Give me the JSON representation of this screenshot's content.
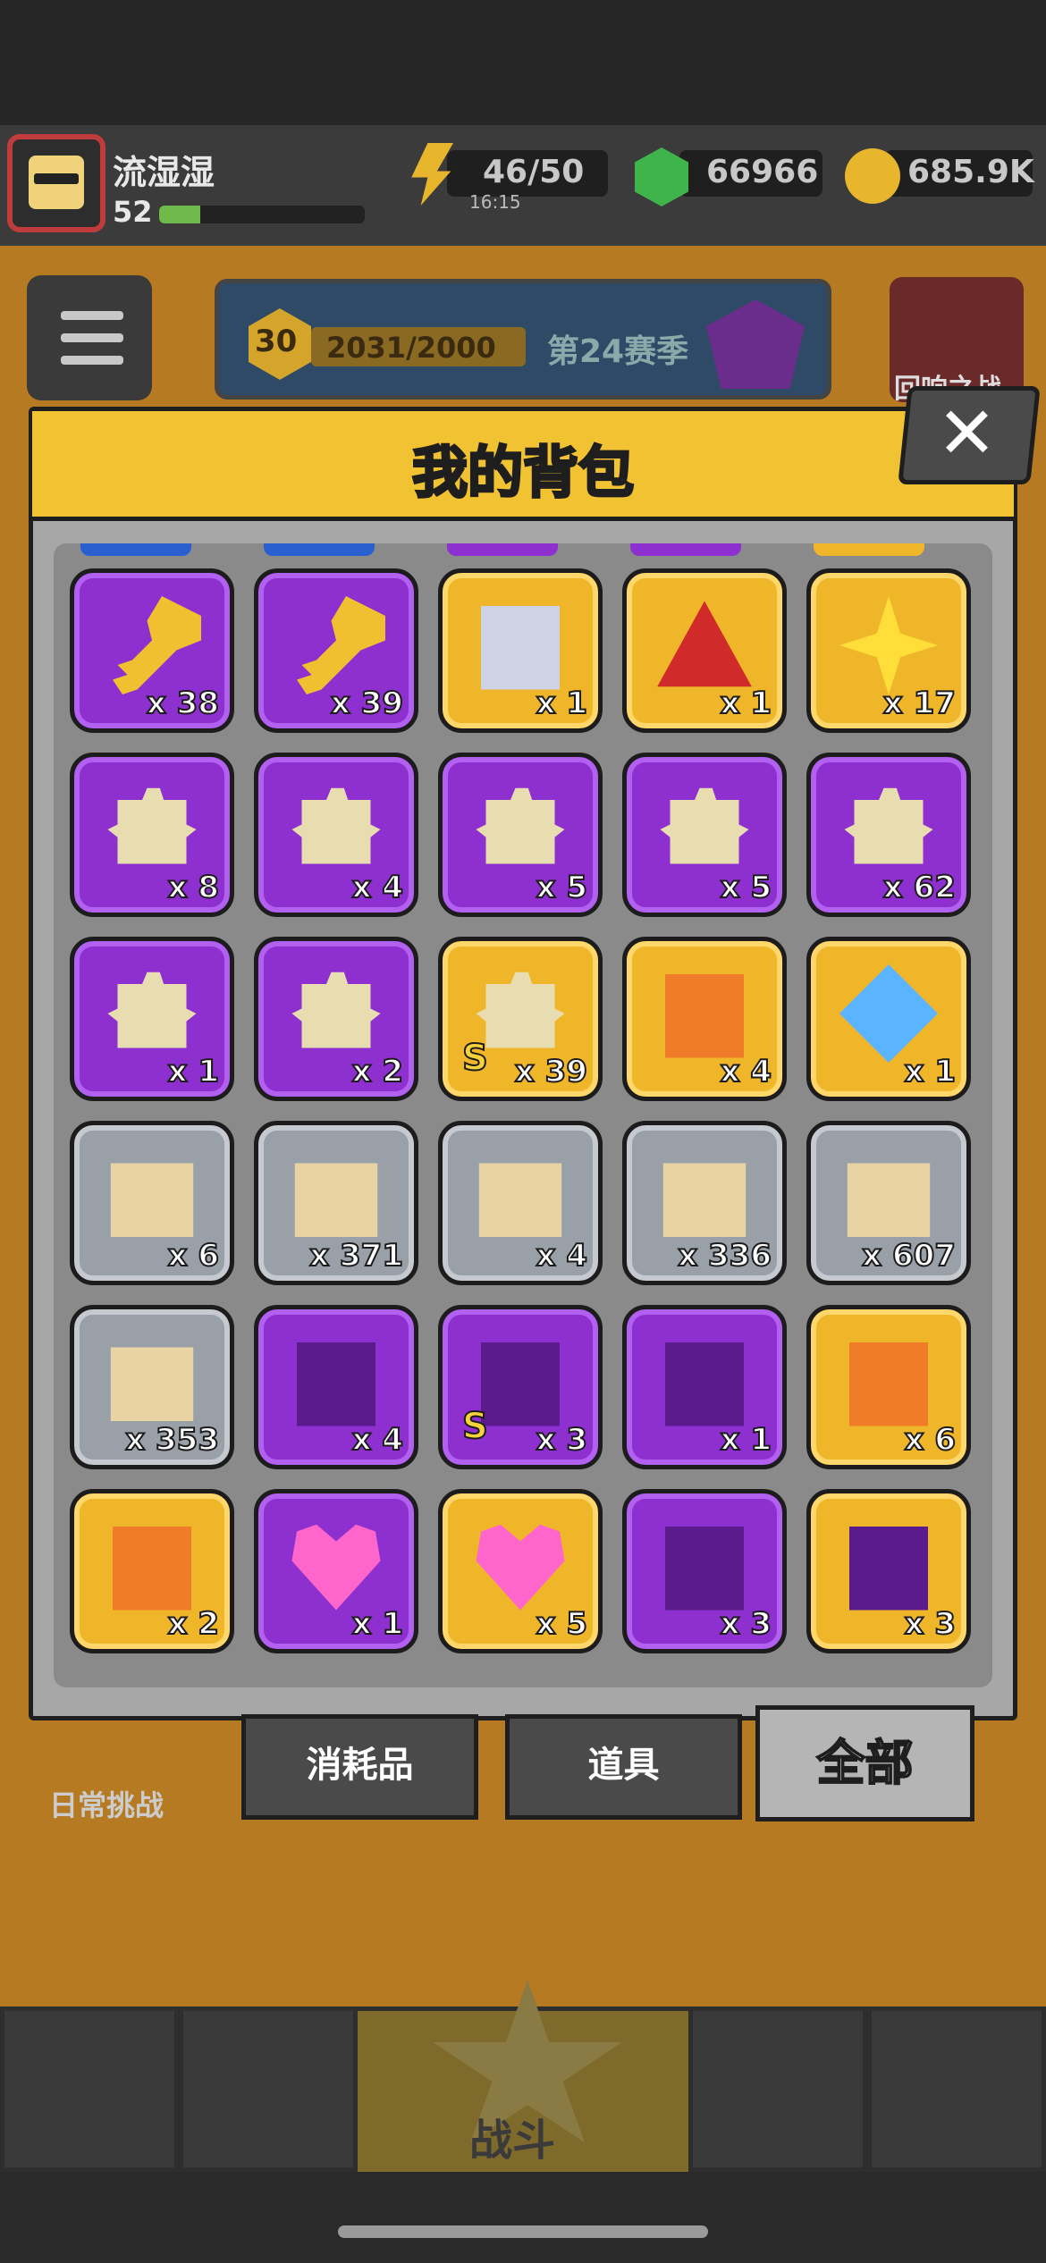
{
  "topbar": {
    "player_name": "流湿湿",
    "player_level": "52",
    "energy": "46/50",
    "energy_timer": "16:15",
    "gems": "66966",
    "coins": "685.9K"
  },
  "season": {
    "level": "30",
    "progress": "2031/2000",
    "name": "第24赛季"
  },
  "background": {
    "event_label": "回响之战",
    "daily_label": "日常挑战",
    "fight_label": "战斗"
  },
  "dialog": {
    "title": "我的背包",
    "close": "✕"
  },
  "items": [
    {
      "icon": "purple-gem-key-icon",
      "rarity": "purple",
      "count": "x 38"
    },
    {
      "icon": "gold-gem-key-icon",
      "rarity": "purple",
      "count": "x 39"
    },
    {
      "icon": "emblem-chest-icon",
      "rarity": "gold",
      "count": "x 1"
    },
    {
      "icon": "red-triangle-icon",
      "rarity": "gold",
      "count": "x 1"
    },
    {
      "icon": "gold-star-icon",
      "rarity": "gold",
      "count": "x 17"
    },
    {
      "icon": "hero-shard-icon",
      "rarity": "purple",
      "count": "x 8"
    },
    {
      "icon": "hero-shard-icon",
      "rarity": "purple",
      "count": "x 4"
    },
    {
      "icon": "hero-shard-icon",
      "rarity": "purple",
      "count": "x 5"
    },
    {
      "icon": "hero-shard-icon",
      "rarity": "purple",
      "count": "x 5"
    },
    {
      "icon": "hero-shard-icon",
      "rarity": "purple",
      "count": "x 62"
    },
    {
      "icon": "hero-shard-icon",
      "rarity": "purple",
      "count": "x 1"
    },
    {
      "icon": "hero-shard-icon",
      "rarity": "purple",
      "count": "x 2"
    },
    {
      "icon": "hero-shard-icon",
      "rarity": "gold",
      "count": "x 39",
      "badge": "S"
    },
    {
      "icon": "gold-chest-icon",
      "rarity": "gold",
      "count": "x 4"
    },
    {
      "icon": "energy-triangle-icon",
      "rarity": "gold",
      "count": "x 1"
    },
    {
      "icon": "weapon-blueprint-icon",
      "rarity": "grey",
      "count": "x 6"
    },
    {
      "icon": "armor-blueprint-icon",
      "rarity": "grey",
      "count": "x 371"
    },
    {
      "icon": "necklace-blueprint-icon",
      "rarity": "grey",
      "count": "x 4"
    },
    {
      "icon": "belt-blueprint-icon",
      "rarity": "grey",
      "count": "x 336"
    },
    {
      "icon": "glove-blueprint-icon",
      "rarity": "grey",
      "count": "x 607"
    },
    {
      "icon": "boots-blueprint-icon",
      "rarity": "grey",
      "count": "x 353"
    },
    {
      "icon": "purple-chest-icon",
      "rarity": "purple",
      "count": "x 4"
    },
    {
      "icon": "purple-chest-icon",
      "rarity": "purple",
      "count": "x 3",
      "badge": "S"
    },
    {
      "icon": "purple-hex-chest-icon",
      "rarity": "purple",
      "count": "x 1"
    },
    {
      "icon": "gold-hex-chest-icon",
      "rarity": "gold",
      "count": "x 6"
    },
    {
      "icon": "emerald-chest-icon",
      "rarity": "gold",
      "count": "x 2"
    },
    {
      "icon": "heart-gift-icon",
      "rarity": "purple",
      "count": "x 1"
    },
    {
      "icon": "heart-gift-icon",
      "rarity": "gold",
      "count": "x 5"
    },
    {
      "icon": "pet-chest-icon",
      "rarity": "purple",
      "count": "x 3"
    },
    {
      "icon": "pet-chest-icon",
      "rarity": "gold",
      "count": "x 3"
    }
  ],
  "tabs": {
    "consumables": "消耗品",
    "props": "道具",
    "all": "全部"
  },
  "colors": {
    "purple_tile": "#8e2fd0",
    "gold_tile": "#f0b62a",
    "grey_tile": "#9aa0a8",
    "header_yellow": "#f1c232"
  }
}
